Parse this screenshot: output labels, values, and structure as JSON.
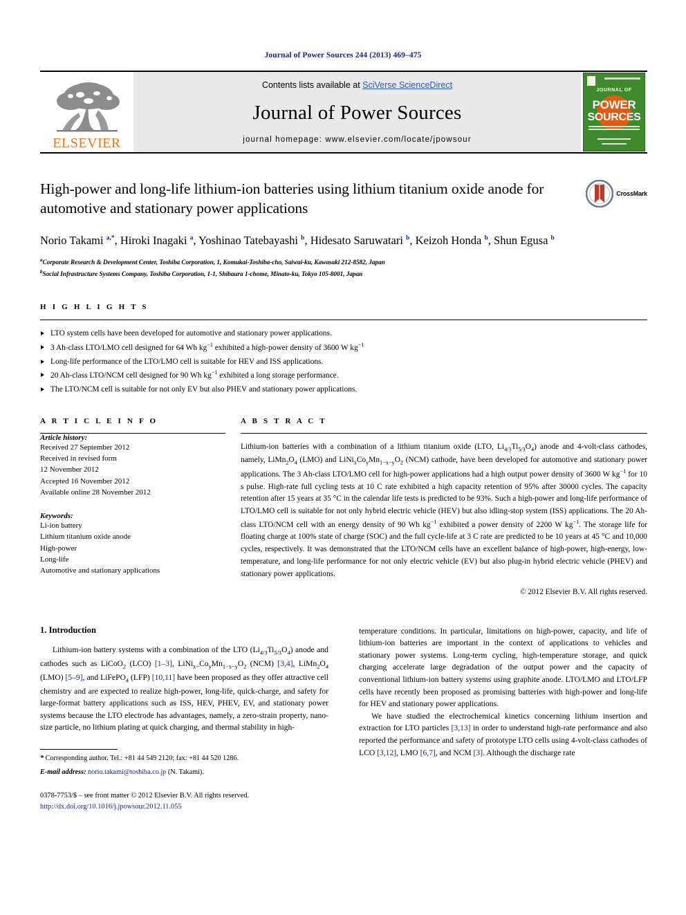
{
  "running_head": "Journal of Power Sources 244 (2013) 469–475",
  "masthead": {
    "publisher_logo_label": "ELSEVIER",
    "contents_prefix": "Contents lists available at ",
    "contents_link": "SciVerse ScienceDirect",
    "journal_name": "Journal of Power Sources",
    "homepage": "journal homepage: www.elsevier.com/locate/jpowsour",
    "cover": {
      "line1": "JOURNAL OF",
      "line2": "POWER",
      "line3": "SOURCES",
      "bg_color": "#3f8a2e",
      "accent_color": "#e05a12"
    }
  },
  "article": {
    "title": "High-power and long-life lithium-ion batteries using lithium titanium oxide anode for automotive and stationary power applications",
    "crossmark_label": "CrossMark",
    "authors_line1": "Norio Takami",
    "authors_html": "Norio Takami <sup>a,*</sup>, Hiroki Inagaki <sup>a</sup>, Yoshinao Tatebayashi <sup>b</sup>, Hidesato Saruwatari <sup>b</sup>, Keizoh Honda <sup>b</sup>, Shun Egusa <sup>b</sup>",
    "affiliations": [
      {
        "marker": "a",
        "text": "Corporate Research & Development Center, Toshiba Corporation, 1, Komukai-Toshiba-cho, Saiwai-ku, Kawasaki 212-8582, Japan"
      },
      {
        "marker": "b",
        "text": "Social Infrastructure Systems Company, Toshiba Corporation, 1-1, Shibaura 1-chome, Minato-ku, Tokyo 105-8001, Japan"
      }
    ]
  },
  "highlights": {
    "heading": "H I G H L I G H T S",
    "items": [
      "LTO system cells have been developed for automotive and stationary power applications.",
      "3 Ah-class LTO/LMO cell designed for 64 Wh kg<sup class=\"sup\">−1</sup> exhibited a high-power density of 3600 W kg<sup class=\"sup\">−1</sup>",
      "Long-life performance of the LTO/LMO cell is suitable for HEV and ISS applications.",
      "20 Ah-class LTO/NCM cell designed for 90 Wh kg<sup class=\"sup\">−1</sup> exhibited a long storage performance.",
      "The LTO/NCM cell is suitable for not only EV but also PHEV and stationary power applications."
    ]
  },
  "article_info": {
    "heading": "A R T I C L E   I N F O",
    "history_label": "Article history:",
    "history_lines": [
      "Received 27 September 2012",
      "Received in revised form",
      "12 November 2012",
      "Accepted 16 November 2012",
      "Available online 28 November 2012"
    ],
    "keywords_label": "Keywords:",
    "keywords": [
      "Li-ion battery",
      "Lithium titanium oxide anode",
      "High-power",
      "Long-life",
      "Automotive and stationary applications"
    ]
  },
  "abstract": {
    "heading": "A B S T R A C T",
    "body_html": "Lithium-ion batteries with a combination of a lithium titanium oxide (LTO, Li<sub class=\"sub\">4/3</sub>Ti<sub class=\"sub\">5/3</sub>O<sub class=\"sub\">4</sub>) anode and 4-volt-class cathodes, namely, LiMn<sub class=\"sub\">2</sub>O<sub class=\"sub\">4</sub> (LMO) and LiNi<sub class=\"sub\">x</sub>Co<sub class=\"sub\">y</sub>Mn<sub class=\"sub\">1−x−y</sub>O<sub class=\"sub\">2</sub> (NCM) cathode, have been developed for automotive and stationary power applications. The 3 Ah-class LTO/LMO cell for high-power applications had a high output power density of 3600 W kg<sup class=\"sup\">−1</sup> for 10 s pulse. High-rate full cycling tests at 10 C rate exhibited a high capacity retention of 95% after 30000 cycles. The capacity retention after 15 years at 35 °C in the calendar life tests is predicted to be 93%. Such a high-power and long-life performance of LTO/LMO cell is suitable for not only hybrid electric vehicle (HEV) but also idling-stop system (ISS) applications. The 20 Ah-class LTO/NCM cell with an energy density of 90 Wh kg<sup class=\"sup\">−1</sup> exhibited a power density of 2200 W kg<sup class=\"sup\">−1</sup>. The storage life for floating charge at 100% state of charge (SOC) and the full cycle-life at 3 C rate are predicted to be 10 years at 45 °C and 10,000 cycles, respectively. It was demonstrated that the LTO/NCM cells have an excellent balance of high-power, high-energy, low-temperature, and long-life performance for not only electric vehicle (EV) but also plug-in hybrid electric vehicle (PHEV) and stationary power applications.",
    "copyright": "© 2012 Elsevier B.V. All rights reserved."
  },
  "introduction": {
    "heading": "1.  Introduction",
    "left_para_html": "Lithium-ion battery systems with a combination of the LTO (Li<sub class=\"sub\">4/</sub><sub class=\"sub\">3</sub>Ti<sub class=\"sub\">5/3</sub>O<sub class=\"sub\">4</sub>) anode and cathodes such as LiCoO<sub class=\"sub\">2</sub> (LCO) <span class=\"ref\">[1–3]</span>, LiNi<sub class=\"sub\">x−</sub>Co<sub class=\"sub\">y</sub>Mn<sub class=\"sub\">1−x−y</sub>O<sub class=\"sub\">2</sub> (NCM) <span class=\"ref\">[3,4]</span>, LiMn<sub class=\"sub\">2</sub>O<sub class=\"sub\">4</sub> (LMO) <span class=\"ref\">[5–9]</span>, and LiFePO<sub class=\"sub\">4</sub> (LFP) <span class=\"ref\">[10,11]</span> have been proposed as they offer attractive cell chemistry and are expected to realize high-power, long-life, quick-charge, and safety for large-format battery applications such as ISS, HEV, PHEV, EV, and stationary power systems because the LTO electrode has advantages, namely, a zero-strain property, nano-size particle, no lithium plating at quick charging, and thermal stability in high-",
    "right_para1_html": "temperature conditions. In particular, limitations on high-power, capacity, and life of lithium-ion batteries are important in the context of applications to vehicles and stationary power systems. Long-term cycling, high-temperature storage, and quick charging accelerate large degradation of the output power and the capacity of conventional lithium-ion battery systems using graphite anode. LTO/LMO and LTO/LFP cells have recently been proposed as promising batteries with high-power and long-life for HEV and stationary power applications.",
    "right_para2_html": "We have studied the electrochemical kinetics concerning lithium insertion and extraction for LTO particles <span class=\"ref\">[3,13]</span> in order to understand high-rate performance and also reported the performance and safety of prototype LTO cells using 4-volt-class cathodes of LCO <span class=\"ref\">[3,12]</span>, LMO <span class=\"ref\">[6,7]</span>, and NCM <span class=\"ref\">[3]</span>. Although the discharge rate"
  },
  "footer": {
    "corresponding_html": "<span class=\"em\">*</span>  Corresponding author. Tel.: +81 44 549 2120; fax: +81 44 520 1286.",
    "email_html": "<span class=\"em\">E-mail address:</span> <a href=\"#\">norio.takami@toshiba.co.jp</a> (N. Takami).",
    "frontmatter_html": "0378-7753/$ – see front matter © 2012 Elsevier B.V. All rights reserved.",
    "doi_html": "http://dx.doi.org/10.1016/j.jpowsour.2012.11.055"
  }
}
